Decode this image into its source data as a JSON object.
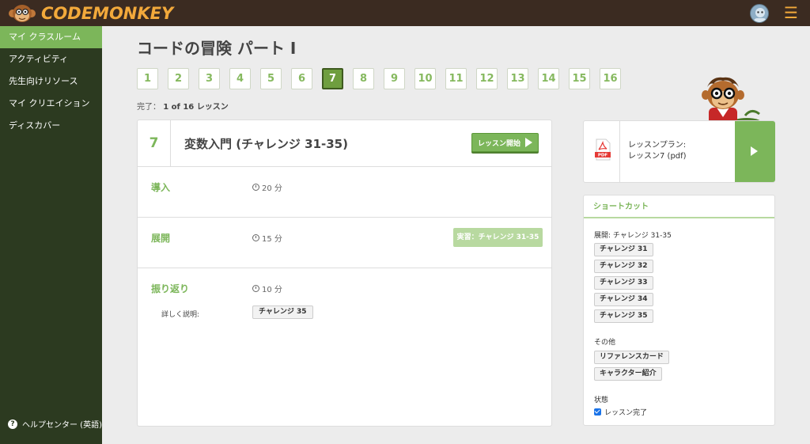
{
  "header": {
    "brand_name": "CODEMONKEY",
    "menu_icon": "hamburger-menu-icon",
    "avatar_icon": "user-avatar"
  },
  "sidebar": {
    "items": [
      {
        "label": "マイ クラスルーム",
        "active": true
      },
      {
        "label": "アクティビティ",
        "active": false
      },
      {
        "label": "先生向けリソース",
        "active": false
      },
      {
        "label": "マイ クリエイション",
        "active": false
      },
      {
        "label": "ディスカバー",
        "active": false
      }
    ],
    "help_label": "ヘルプセンター (英語)"
  },
  "main": {
    "title": "コードの冒険 パート I",
    "lessons": [
      "1",
      "2",
      "3",
      "4",
      "5",
      "6",
      "7",
      "8",
      "9",
      "10",
      "11",
      "12",
      "13",
      "14",
      "15",
      "16"
    ],
    "active_lesson": "7",
    "progress_label": "完了：",
    "progress_value": "1 of 16 レッスン"
  },
  "lesson_card": {
    "number": "7",
    "title": "変数入門 (チャレンジ 31-35)",
    "start_label": "レッスン開始",
    "sections": [
      {
        "title": "導入",
        "time": "20 分"
      },
      {
        "title": "展開",
        "time": "15 分",
        "practice_label": "実習：チャレンジ 31-35"
      },
      {
        "title": "振り返り",
        "time": "10 分",
        "detail_label": "詳しく説明:",
        "detail_button": "チャレンジ 35"
      }
    ]
  },
  "plan_card": {
    "line1": "レッスンプラン:",
    "line2": "レッスン7 (pdf)",
    "pdf_badge": "PDF"
  },
  "shortcuts": {
    "title": "ショートカット",
    "group1_label": "展開: チャレンジ 31-35",
    "challenges": [
      "チャレンジ 31",
      "チャレンジ 32",
      "チャレンジ 33",
      "チャレンジ 34",
      "チャレンジ 35"
    ],
    "group2_label": "その他",
    "others": [
      "リファレンスカード",
      "キャラクター紹介"
    ],
    "status_label": "状態",
    "status_checkbox": "レッスン完了",
    "status_checked": true
  },
  "colors": {
    "accent_green": "#7cb65a",
    "topbar": "#3b2b21",
    "sidebar": "#2c3a20",
    "brand_orange": "#f2a93b"
  }
}
